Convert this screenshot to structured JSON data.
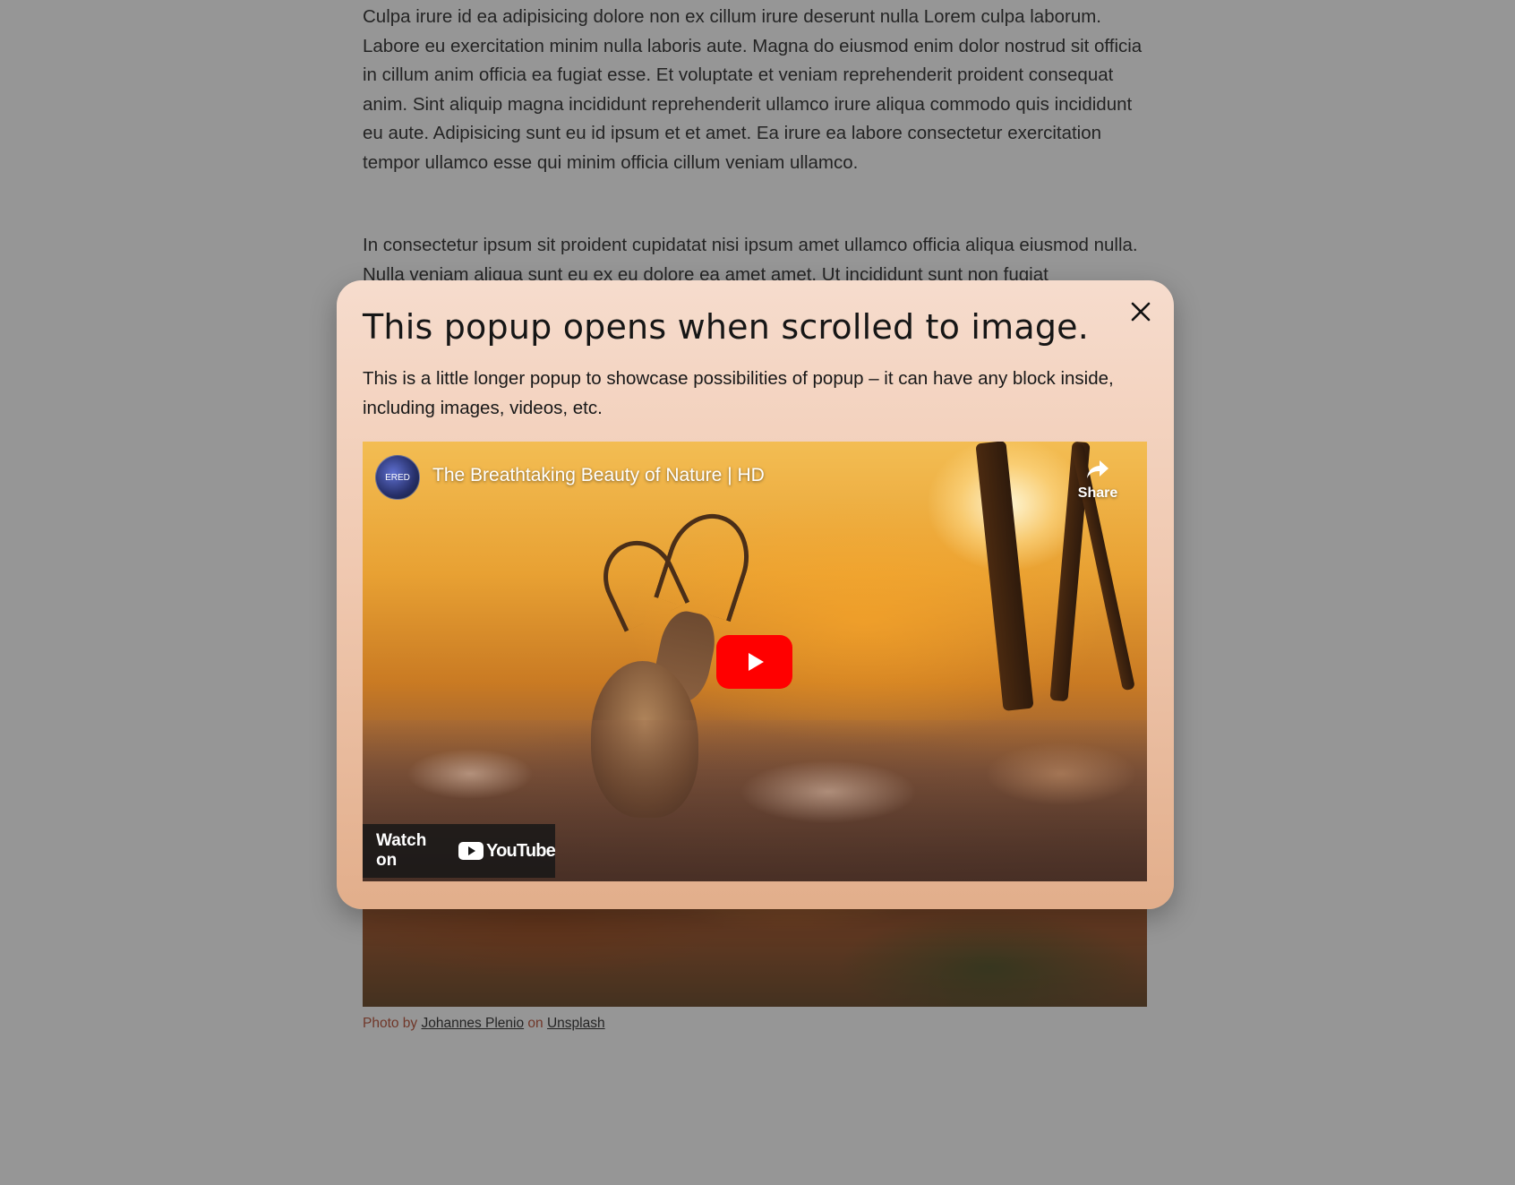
{
  "article": {
    "paragraph_1": "Culpa irure id ea adipisicing dolore non ex cillum irure deserunt nulla Lorem culpa laborum. Labore eu exercitation minim nulla laboris aute. Magna do eiusmod enim dolor nostrud sit officia in cillum anim officia ea fugiat esse. Et voluptate et veniam reprehenderit proident consequat anim. Sint aliquip magna incididunt reprehenderit ullamco irure aliqua commodo quis incididunt eu aute. Adipisicing sunt eu id ipsum et et amet. Ea irure ea labore consectetur exercitation tempor ullamco esse qui minim officia cillum veniam ullamco.",
    "paragraph_2": "In consectetur ipsum sit proident cupidatat nisi ipsum amet ullamco officia aliqua eiusmod nulla. Nulla veniam aliqua sunt eu ex eu dolore ea amet amet. Ut incididunt sunt non fugiat"
  },
  "caption": {
    "prefix": "Photo by ",
    "author": "Johannes Plenio",
    "middle": " on ",
    "source": "Unsplash"
  },
  "popup": {
    "title": "This popup opens when scrolled to image.",
    "text": "This is a little longer popup to showcase possibilities of popup – it can have any block inside, including images, videos, etc.",
    "close_icon": "close-icon"
  },
  "video": {
    "channel_avatar_text": "ERED",
    "title": "The Breathtaking Beauty of Nature | HD",
    "share_label": "Share",
    "watch_on_label": "Watch on",
    "youtube_logo_text": "YouTube"
  },
  "colors": {
    "youtube_red": "#ff0000",
    "caption_accent": "#b4452a",
    "popup_top": "#f6dccd",
    "popup_bottom": "#e2ae8b"
  }
}
